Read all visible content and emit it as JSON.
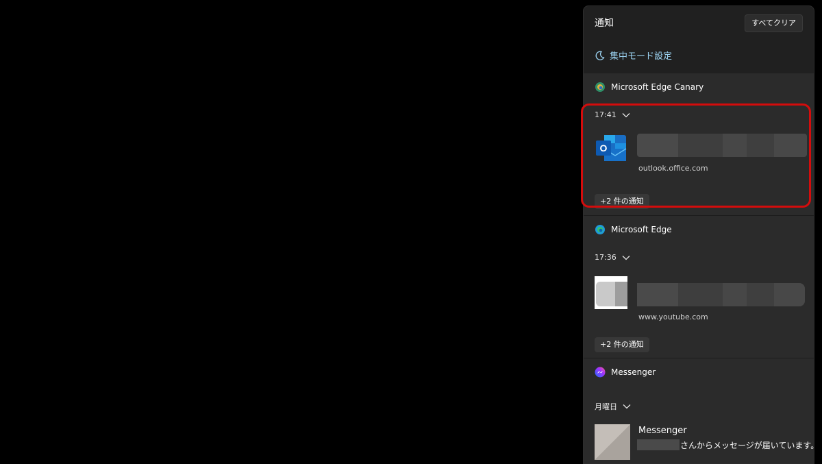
{
  "panel": {
    "title": "通知",
    "clear_all_label": "すべてクリア",
    "focus_settings_label": "集中モード設定"
  },
  "groups": [
    {
      "app_name": "Microsoft Edge Canary",
      "app_icon": "edge-canary-icon",
      "time": "17:41",
      "thumbnail_icon": "outlook-icon",
      "source": "outlook.office.com",
      "more_label": "+2 件の通知"
    },
    {
      "app_name": "Microsoft Edge",
      "app_icon": "edge-icon",
      "time": "17:36",
      "thumbnail_icon": "blurred-thumbnail",
      "source": "www.youtube.com",
      "more_label": "+2 件の通知"
    },
    {
      "app_name": "Messenger",
      "app_icon": "messenger-icon",
      "time": "月曜日",
      "thumbnail_icon": "blurred-avatar",
      "message_title": "Messenger",
      "message_body": "さんからメッセージが届いています。"
    }
  ],
  "colors": {
    "background": "#000000",
    "panel": "#202020",
    "group": "#2b2b2b",
    "accent_link": "#9cd3f2",
    "highlight_border": "#d40c0c"
  }
}
